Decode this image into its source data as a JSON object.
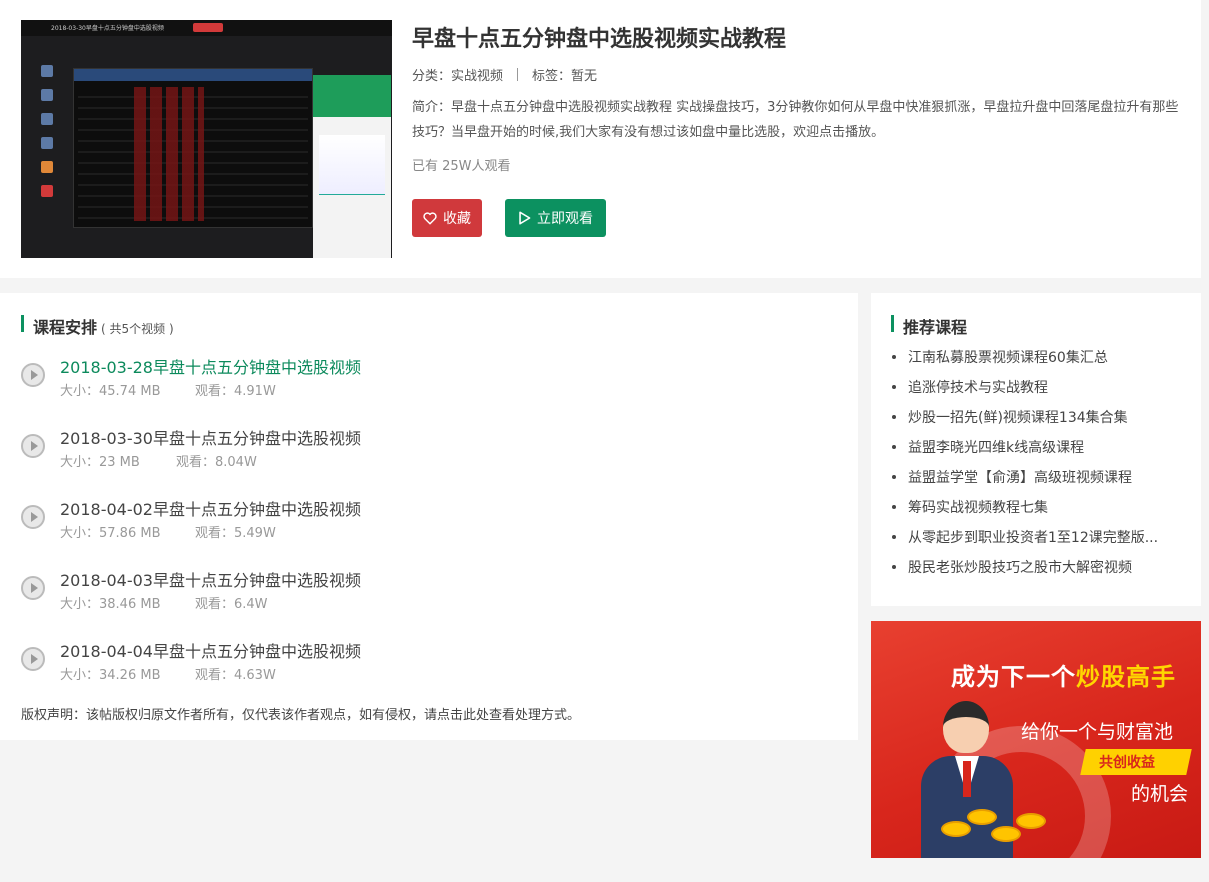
{
  "course": {
    "title": "早盘十点五分钟盘中选股视频实战教程",
    "category": "分类：实战视频",
    "tags": "标签：暂无",
    "description": "简介：早盘十点五分钟盘中选股视频实战教程 实战操盘技巧，3分钟教你如何从早盘中快准狠抓涨，早盘拉升盘中回落尾盘拉升有那些技巧？当早盘开始的时候,我们大家有没有想过该如盘中量比选股，欢迎点击播放。",
    "viewers": "已有 25W人观看",
    "favorite_label": "收藏",
    "watch_label": "立即观看",
    "thumbnail_caption": "2018-03-30早盘十点五分钟盘中选股视频"
  },
  "schedule": {
    "title": "课程安排",
    "count_text": "( 共5个视频 )",
    "items": [
      {
        "name": "2018-03-28早盘十点五分钟盘中选股视频",
        "size": "大小：45.74 MB",
        "views": "观看：4.91W",
        "active": true
      },
      {
        "name": "2018-03-30早盘十点五分钟盘中选股视频",
        "size": "大小：23 MB",
        "views": "观看：8.04W",
        "active": false
      },
      {
        "name": "2018-04-02早盘十点五分钟盘中选股视频",
        "size": "大小：57.86 MB",
        "views": "观看：5.49W",
        "active": false
      },
      {
        "name": "2018-04-03早盘十点五分钟盘中选股视频",
        "size": "大小：38.46 MB",
        "views": "观看：6.4W",
        "active": false
      },
      {
        "name": "2018-04-04早盘十点五分钟盘中选股视频",
        "size": "大小：34.26 MB",
        "views": "观看：4.63W",
        "active": false
      }
    ],
    "copyright": "版权声明：该帖版权归原文作者所有，仅代表该作者观点，如有侵权，请点击此处查看处理方式。"
  },
  "recommend": {
    "title": "推荐课程",
    "items": [
      "江南私募股票视频课程60集汇总",
      "追涨停技术与实战教程",
      "炒股一招先(鲜)视频课程134集合集",
      "益盟李晓光四维k线高级课程",
      "益盟益学堂【俞湧】高级班视频课程",
      "筹码实战视频教程七集",
      "从零起步到职业投资者1至12课完整版...",
      "股民老张炒股技巧之股市大解密视频"
    ]
  },
  "ad": {
    "headline_a": "成为下一个",
    "headline_b": "炒股高手",
    "line2": "给你一个与财富池",
    "ribbon": "共创收益",
    "line4": "的机会"
  },
  "colors": {
    "accent_green": "#0c9160",
    "favorite_red": "#d0393c"
  }
}
